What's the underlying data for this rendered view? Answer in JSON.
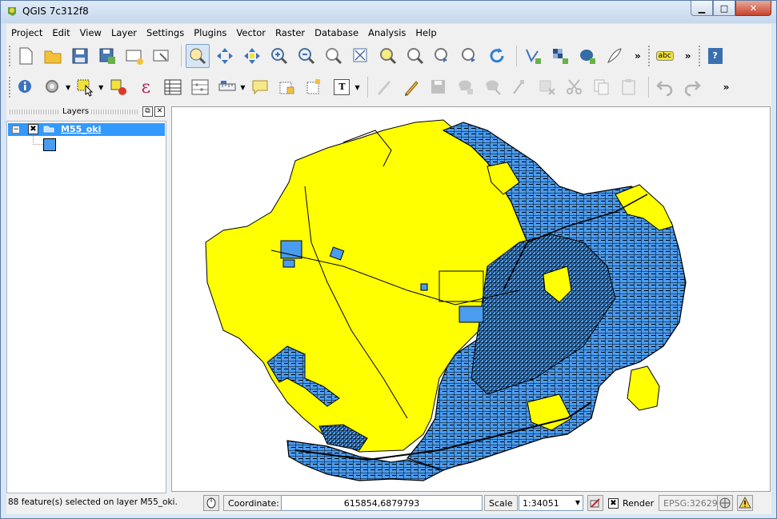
{
  "window": {
    "title": "QGIS 7c312f8",
    "minimize": "▁",
    "maximize": "□",
    "close": "✕"
  },
  "menu": [
    "Project",
    "Edit",
    "View",
    "Layer",
    "Settings",
    "Plugins",
    "Vector",
    "Raster",
    "Database",
    "Analysis",
    "Help"
  ],
  "toolbar": {
    "overflow": "»",
    "label_tool_text": "abc",
    "help_text": "?",
    "text_tool_text": "T",
    "epsilon": "ε"
  },
  "layers_panel": {
    "title": "Layers",
    "float_button": "⧉",
    "close_button": "✕",
    "layer": {
      "name": "M55_oki",
      "expander": "−",
      "checked": "✖"
    }
  },
  "colors": {
    "selection": "#ffff00",
    "feature_fill": "#4a9cf0",
    "outline": "#000000"
  },
  "statusbar": {
    "message": "88 feature(s) selected on layer M55_oki.",
    "coordinate_label": "Coordinate:",
    "coordinate_value": "615854,6879793",
    "scale_label": "Scale",
    "scale_value": "1:34051",
    "render_label": "Render",
    "render_checked": "✖",
    "crs": "EPSG:32629"
  }
}
